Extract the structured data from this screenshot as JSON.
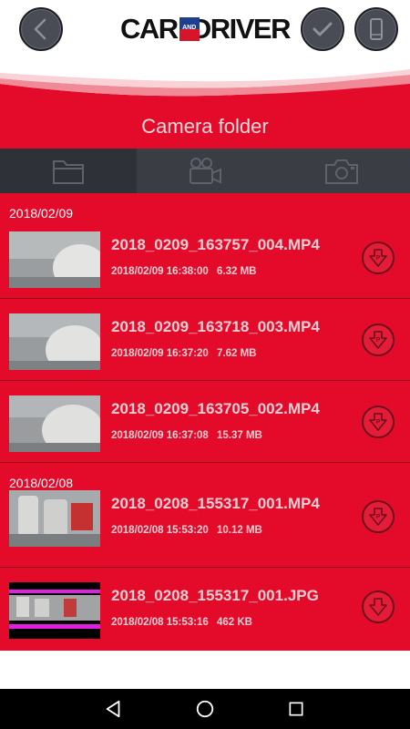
{
  "header": {
    "logo_left": "CAR",
    "logo_mid": "AND",
    "logo_right": "DRIVER",
    "back_icon": "chevron-left-icon",
    "check_icon": "checkmark-icon",
    "device_icon": "phone-icon"
  },
  "title": "Camera folder",
  "tabs": [
    {
      "icon": "folder-icon",
      "active": true
    },
    {
      "icon": "video-camera-icon",
      "active": false
    },
    {
      "icon": "photo-camera-icon",
      "active": false
    }
  ],
  "groups": [
    {
      "date": "2018/02/09",
      "files": [
        {
          "name": "2018_0209_163757_004.MP4",
          "datetime": "2018/02/09 16:38:00",
          "size": "6.32 MB",
          "type": "video"
        },
        {
          "name": "2018_0209_163718_003.MP4",
          "datetime": "2018/02/09 16:37:20",
          "size": "7.62 MB",
          "type": "video"
        },
        {
          "name": "2018_0209_163705_002.MP4",
          "datetime": "2018/02/09 16:37:08",
          "size": "15.37 MB",
          "type": "video"
        }
      ]
    },
    {
      "date": "2018/02/08",
      "files": [
        {
          "name": "2018_0208_155317_001.MP4",
          "datetime": "2018/02/08 15:53:20",
          "size": "10.12 MB",
          "type": "video"
        },
        {
          "name": "2018_0208_155317_001.JPG",
          "datetime": "2018/02/08 15:53:16",
          "size": "462 KB",
          "type": "photo"
        }
      ]
    }
  ],
  "colors": {
    "accent_red": "#e30a2a",
    "tab_bar": "#3b3d45",
    "text_light": "#f6cfd4"
  },
  "navbar": {
    "back": "nav-back-icon",
    "home": "nav-home-icon",
    "recents": "nav-recents-icon"
  }
}
